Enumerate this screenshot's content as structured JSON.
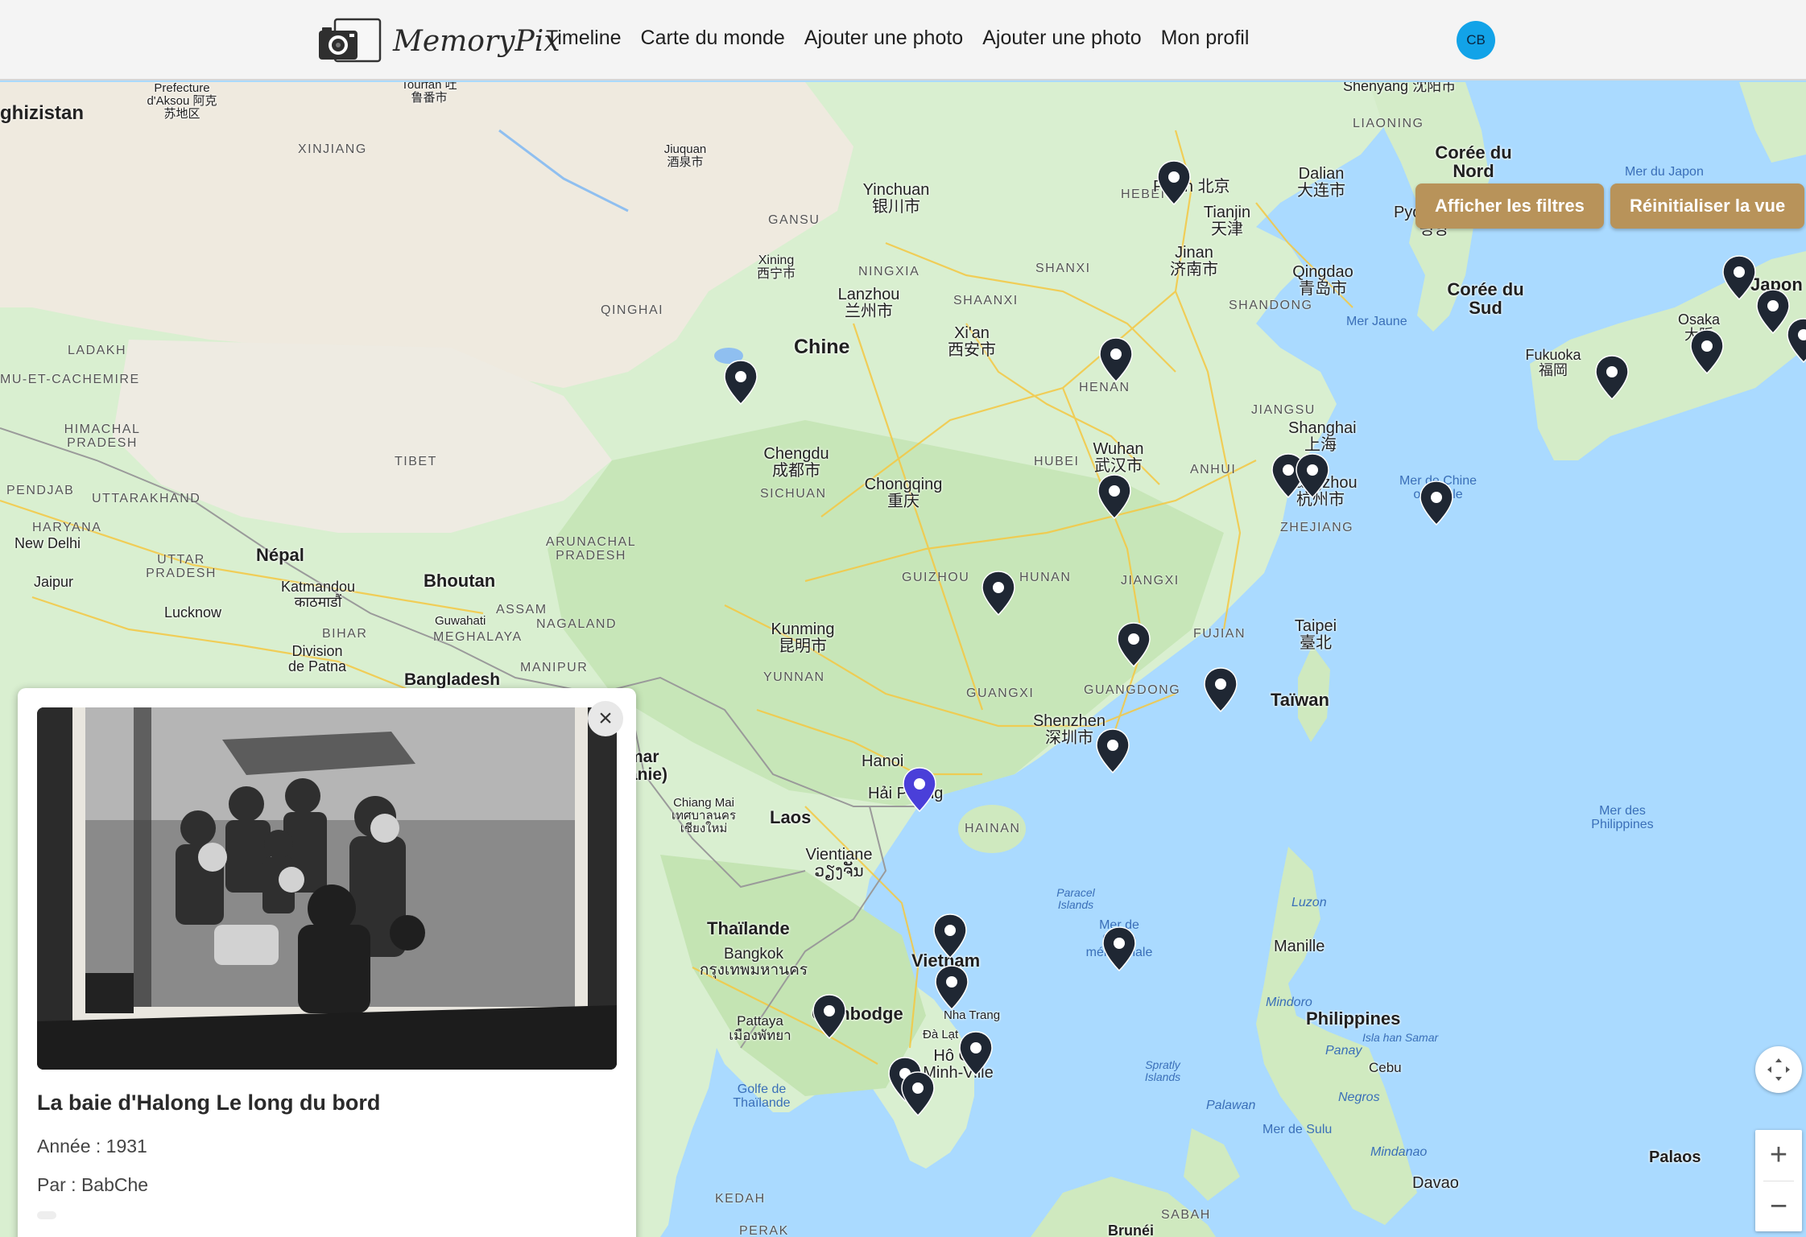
{
  "app": {
    "name": "MemoryPix"
  },
  "nav": {
    "links": [
      "Timeline",
      "Carte du monde",
      "Ajouter une photo",
      "Ajouter une photo",
      "Mon profil"
    ],
    "avatar_initials": "CB"
  },
  "map_controls": {
    "filters_label": "Afficher les filtres",
    "reset_label": "Réinitialiser la vue",
    "zoom_in": "+",
    "zoom_out": "−"
  },
  "popup": {
    "title": "La baie d'Halong Le long du bord",
    "year": "Année : 1931",
    "author": "Par : BabChe",
    "close_glyph": "×"
  },
  "map": {
    "countries": [
      "Chine",
      "Népal",
      "Bhoutan",
      "Laos",
      "Thaïlande",
      "Cambodge",
      "Vietnam",
      "Philippines",
      "Taïwan",
      "Corée du Nord",
      "Corée du Sud",
      "Japon",
      "Bangladesh",
      "Palaos",
      "Brunéi"
    ],
    "regions": [
      "XINJIANG",
      "GANSU",
      "QINGHAI",
      "NINGXIA",
      "SHAANXI",
      "SHANXI",
      "HEBEI",
      "SHANDONG",
      "HENAN",
      "HUBEI",
      "ANHUI",
      "JIANGSU",
      "ZHEJIANG",
      "SICHUAN",
      "GUIZHOU",
      "HUNAN",
      "JIANGXI",
      "FUJIAN",
      "YUNNAN",
      "GUANGXI",
      "GUANGDONG",
      "HAINAN",
      "TIBET",
      "LADAKH",
      "HIMACHAL PRADESH",
      "PENDJAB",
      "UTTARAKHAND",
      "HARYANA",
      "UTTAR PRADESH",
      "BIHAR",
      "ASSAM",
      "MEGHALAYA",
      "NAGALAND",
      "MANIPUR",
      "ARUNACHAL PRADESH",
      "LIAONING",
      "SABAH",
      "PERAK",
      "KEDAH"
    ],
    "cities": [
      "Pékin 北京",
      "Tianjin 天津",
      "Dalian 大连市",
      "Pyongyang 평양",
      "Jinan 济南市",
      "Qingdao 青岛市",
      "Yinchuan 银川市",
      "Lanzhou 兰州市",
      "Xining 西宁市",
      "Xi'an 西安市",
      "Chengdu 成都市",
      "Chongqing 重庆",
      "Wuhan 武汉市",
      "Shanghai 上海",
      "Hangzhou 杭州市",
      "Kunming 昆明市",
      "Shenzhen 深圳市",
      "Taipei 臺北",
      "Hanoi",
      "Hải Phòng",
      "Vientiane ວຽງຈັນ",
      "Bangkok กรุงเทพมหานคร",
      "Pattaya เมืองพัทยา",
      "Chiang Mai เทศบาลนครเชียงใหม่",
      "Hô Chi Minh-Ville",
      "Nha Trang",
      "Đà Lạt",
      "Manille",
      "Cebu",
      "Davao",
      "Fukuoka 福岡",
      "Osaka 大阪",
      "Katmandou काठमाडौं",
      "New Delhi",
      "Lucknow",
      "Jaipur",
      "Division de Patna",
      "Guwahati",
      "Jiuquan 酒泉市",
      "Prefecture d'Aksou 阿克苏地区",
      "Tourfan 吐鲁番市",
      "Luzon",
      "Mindoro",
      "Panay",
      "Negros",
      "Mindanao",
      "Palawan"
    ],
    "seas": [
      "Mer du Japon",
      "Mer Jaune",
      "Mer de Chine orientale",
      "Mer des Philippines",
      "Mer de Chine méridionale",
      "Golfe de Thaïlande",
      "Mer de Sulu",
      "Isla han Samar",
      "Paracel Islands",
      "Spratly Islands"
    ],
    "partial_labels": [
      "ghizistan",
      "MU-ET-CACHEMIRE",
      "Shenyang 沈阳市",
      "mar anie)"
    ],
    "marker_count": 26,
    "selected_marker_color": "#4a3fd9"
  }
}
